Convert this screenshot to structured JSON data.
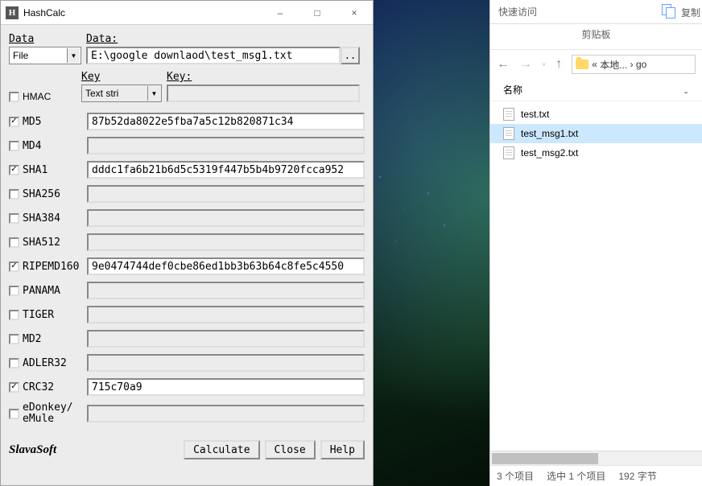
{
  "hashcalc": {
    "title": "HashCalc",
    "minimize": "–",
    "maximize": "□",
    "close": "×",
    "labels": {
      "data_format": "Data",
      "data": "Data:",
      "key_format": "Key",
      "key": "Key:",
      "hmac": "HMAC"
    },
    "data_format_value": "File",
    "data_value": "E:\\google downlaod\\test_msg1.txt",
    "browse_btn": "..",
    "key_format_value": "Text stri",
    "key_value": "",
    "hmac_checked": false,
    "hashes": [
      {
        "name": "MD5",
        "checked": true,
        "value": "87b52da8022e5fba7a5c12b820871c34"
      },
      {
        "name": "MD4",
        "checked": false,
        "value": ""
      },
      {
        "name": "SHA1",
        "checked": true,
        "value": "dddc1fa6b21b6d5c5319f447b5b4b9720fcca952"
      },
      {
        "name": "SHA256",
        "checked": false,
        "value": ""
      },
      {
        "name": "SHA384",
        "checked": false,
        "value": ""
      },
      {
        "name": "SHA512",
        "checked": false,
        "value": ""
      },
      {
        "name": "RIPEMD160",
        "checked": true,
        "value": "9e0474744def0cbe86ed1bb3b63b64c8fe5c4550"
      },
      {
        "name": "PANAMA",
        "checked": false,
        "value": ""
      },
      {
        "name": "TIGER",
        "checked": false,
        "value": ""
      },
      {
        "name": "MD2",
        "checked": false,
        "value": ""
      },
      {
        "name": "ADLER32",
        "checked": false,
        "value": ""
      },
      {
        "name": "CRC32",
        "checked": true,
        "value": "715c70a9"
      },
      {
        "name": "eDonkey/\neMule",
        "checked": false,
        "value": ""
      }
    ],
    "slavasoft": "SlavaSoft",
    "buttons": {
      "calculate": "Calculate",
      "close": "Close",
      "help": "Help"
    }
  },
  "explorer": {
    "ribbon": {
      "quick_access": "快速访问",
      "copy": "复制",
      "clipboard_label": "剪贴板"
    },
    "path_prefix": "«",
    "path_crumbs": [
      "本地...",
      "go"
    ],
    "path_sep": "›",
    "column_name": "名称",
    "files": [
      {
        "name": "test.txt",
        "selected": false
      },
      {
        "name": "test_msg1.txt",
        "selected": true
      },
      {
        "name": "test_msg2.txt",
        "selected": false
      }
    ],
    "status": {
      "items": "3 个项目",
      "selected": "选中 1 个项目",
      "size": "192 字节"
    }
  }
}
